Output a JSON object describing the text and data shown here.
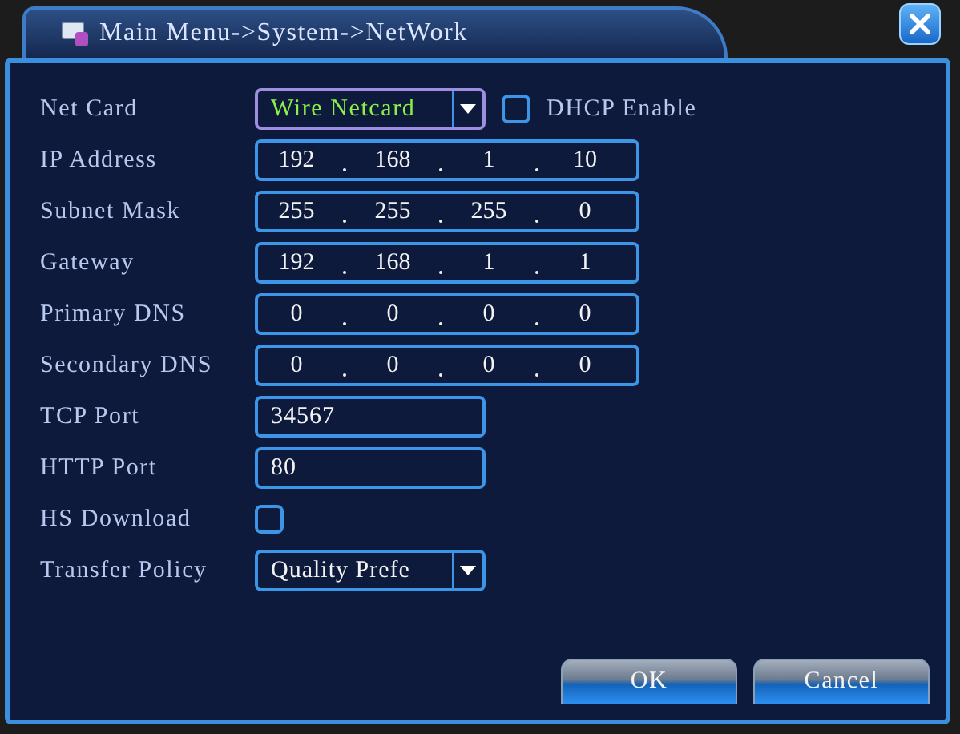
{
  "window": {
    "title": "Main Menu->System->NetWork"
  },
  "rows": [
    {
      "label": "Net Card",
      "kind": "select",
      "value": "Wire Netcard",
      "focused": true,
      "option": {
        "label": "DHCP Enable",
        "checked": false
      }
    },
    {
      "label": "IP Address",
      "kind": "ip",
      "octets": [
        "192",
        "168",
        "1",
        "10"
      ]
    },
    {
      "label": "Subnet Mask",
      "kind": "ip",
      "octets": [
        "255",
        "255",
        "255",
        "0"
      ]
    },
    {
      "label": "Gateway",
      "kind": "ip",
      "octets": [
        "192",
        "168",
        "1",
        "1"
      ]
    },
    {
      "label": "Primary DNS",
      "kind": "ip",
      "octets": [
        "0",
        "0",
        "0",
        "0"
      ]
    },
    {
      "label": "Secondary DNS",
      "kind": "ip",
      "octets": [
        "0",
        "0",
        "0",
        "0"
      ]
    },
    {
      "label": "TCP Port",
      "kind": "text",
      "value": "34567"
    },
    {
      "label": "HTTP Port",
      "kind": "text",
      "value": "80"
    },
    {
      "label": "HS Download",
      "kind": "checkbox",
      "checked": false
    },
    {
      "label": "Transfer Policy",
      "kind": "select",
      "value": "Quality Prefe",
      "focused": false
    }
  ],
  "buttons": [
    "OK",
    "Cancel"
  ]
}
